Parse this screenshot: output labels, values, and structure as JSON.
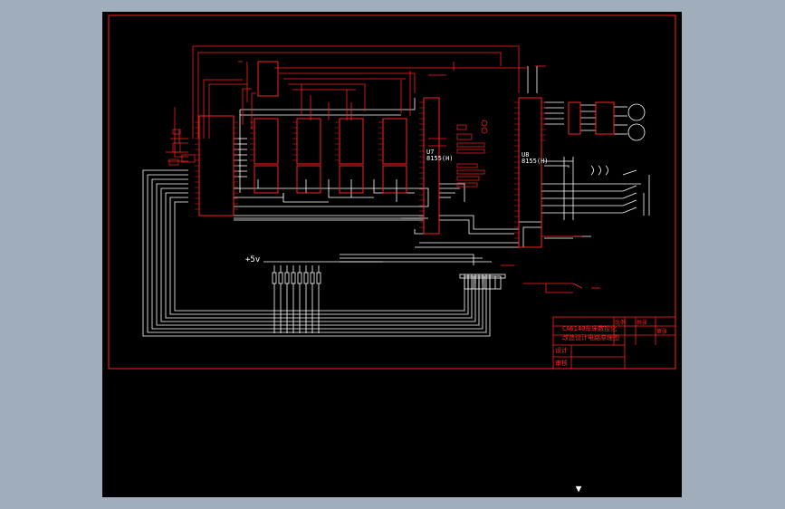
{
  "chips": {
    "u7": {
      "ref": "U7",
      "part": "8155(H)"
    },
    "u8": {
      "ref": "U8",
      "part": "8155(H)"
    }
  },
  "supply": {
    "main": "+5v"
  },
  "title_block": {
    "title_line1": "CA6140车床数控化",
    "title_line2": "改造设计电路原理图",
    "design": "设计",
    "check": "审核",
    "scale": "比例",
    "count": "共张",
    "sheet": "第张"
  },
  "icons": {
    "compass": "north-arrow-icon"
  }
}
